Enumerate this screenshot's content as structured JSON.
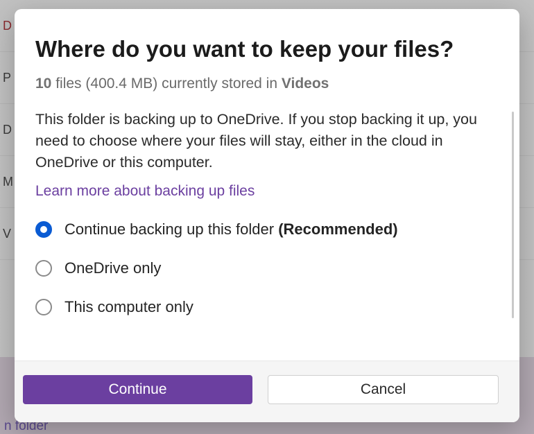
{
  "title": "Where do you want to keep your files?",
  "subtitle": {
    "count": "10",
    "files_word": "files",
    "size": "(400.4 MB)",
    "stored_in": "currently stored in",
    "folder": "Videos"
  },
  "description": "This folder is backing up to OneDrive. If you stop backing it up, you need to choose where your files will stay, either in the cloud in OneDrive or this computer.",
  "learn_link": "Learn more about backing up files",
  "options": {
    "0": {
      "label": "Continue backing up this folder",
      "rec": "(Recommended)",
      "selected": true
    },
    "1": {
      "label": "OneDrive only",
      "rec": "",
      "selected": false
    },
    "2": {
      "label": "This computer only",
      "rec": "",
      "selected": false
    }
  },
  "buttons": {
    "continue": "Continue",
    "cancel": "Cancel"
  },
  "bg": {
    "r0": "D",
    "r1": "P",
    "r2": "D",
    "r3": "M",
    "r4": "V",
    "bottom": "n folder"
  }
}
